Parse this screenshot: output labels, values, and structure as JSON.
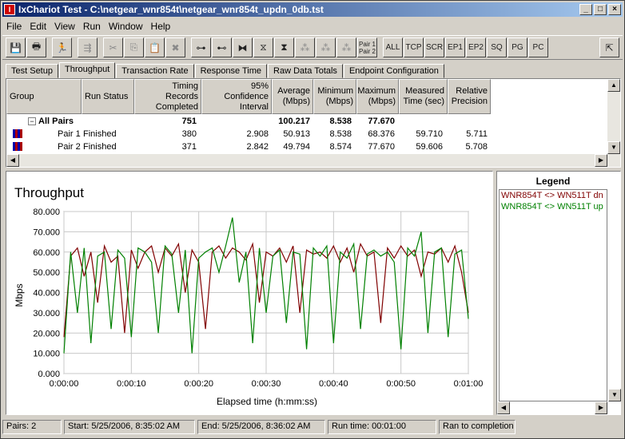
{
  "window": {
    "title": "IxChariot Test - C:\\netgear_wnr854t\\netgear_wnr854t_updn_0db.tst"
  },
  "menu": [
    "File",
    "Edit",
    "View",
    "Run",
    "Window",
    "Help"
  ],
  "toolbar": {
    "pair_label": "Pair 1\nPair 2",
    "text_buttons": [
      "ALL",
      "TCP",
      "SCR",
      "EP1",
      "EP2",
      "SQ",
      "PG",
      "PC"
    ]
  },
  "tabs": [
    "Test Setup",
    "Throughput",
    "Transaction Rate",
    "Response Time",
    "Raw Data Totals",
    "Endpoint Configuration"
  ],
  "table": {
    "headers": [
      "Group",
      "Run Status",
      "Timing Records Completed",
      "95% Confidence Interval",
      "Average (Mbps)",
      "Minimum (Mbps)",
      "Maximum (Mbps)",
      "Measured Time (sec)",
      "Relative Precision"
    ],
    "summary": {
      "group": "All Pairs",
      "records": "751",
      "average": "100.217",
      "minimum": "8.538",
      "maximum": "77.670"
    },
    "rows": [
      {
        "group": "Pair 1",
        "status": "Finished",
        "records": "380",
        "ci": "2.908",
        "average": "50.913",
        "minimum": "8.538",
        "maximum": "68.376",
        "time": "59.710",
        "precision": "5.711"
      },
      {
        "group": "Pair 2",
        "status": "Finished",
        "records": "371",
        "ci": "2.842",
        "average": "49.794",
        "minimum": "8.574",
        "maximum": "77.670",
        "time": "59.606",
        "precision": "5.708"
      }
    ]
  },
  "chart_data": {
    "type": "line",
    "title": "Throughput",
    "xlabel": "Elapsed time (h:mm:ss)",
    "ylabel": "Mbps",
    "ylim": [
      0,
      80
    ],
    "xlim": [
      0,
      60
    ],
    "yticks": [
      "0.000",
      "10.000",
      "20.000",
      "30.000",
      "40.000",
      "50.000",
      "60.000",
      "70.000",
      "80.000"
    ],
    "xticks": [
      "0:00:00",
      "0:00:10",
      "0:00:20",
      "0:00:30",
      "0:00:40",
      "0:00:50",
      "0:01:00"
    ],
    "grid": true,
    "series": [
      {
        "name": "WNR854T <> WN511T dn",
        "color": "#800000",
        "x": [
          0,
          1,
          2,
          3,
          4,
          5,
          6,
          7,
          8,
          9,
          10,
          11,
          12,
          13,
          14,
          15,
          16,
          17,
          18,
          19,
          20,
          21,
          22,
          23,
          24,
          25,
          26,
          27,
          28,
          29,
          30,
          31,
          32,
          33,
          34,
          35,
          36,
          37,
          38,
          39,
          40,
          41,
          42,
          43,
          44,
          45,
          46,
          47,
          48,
          49,
          50,
          51,
          52,
          53,
          54,
          55,
          56,
          57,
          58,
          59,
          60
        ],
        "values": [
          18,
          58,
          62,
          48,
          60,
          35,
          63,
          55,
          58,
          20,
          61,
          52,
          60,
          63,
          50,
          62,
          58,
          64,
          40,
          61,
          55,
          22,
          60,
          63,
          57,
          62,
          60,
          56,
          64,
          35,
          60,
          58,
          62,
          55,
          63,
          30,
          61,
          59,
          60,
          57,
          63,
          55,
          62,
          50,
          64,
          58,
          60,
          25,
          62,
          57,
          63,
          58,
          61,
          48,
          60,
          59,
          62,
          55,
          63,
          50,
          30
        ]
      },
      {
        "name": "WNR854T <> WN511T up",
        "color": "#008000",
        "x": [
          0,
          1,
          2,
          3,
          4,
          5,
          6,
          7,
          8,
          9,
          10,
          11,
          12,
          13,
          14,
          15,
          16,
          17,
          18,
          19,
          20,
          21,
          22,
          23,
          24,
          25,
          26,
          27,
          28,
          29,
          30,
          31,
          32,
          33,
          34,
          35,
          36,
          37,
          38,
          39,
          40,
          41,
          42,
          43,
          44,
          45,
          46,
          47,
          48,
          49,
          50,
          51,
          52,
          53,
          54,
          55,
          56,
          57,
          58,
          59,
          60
        ],
        "values": [
          10,
          60,
          30,
          62,
          15,
          58,
          60,
          22,
          61,
          57,
          18,
          62,
          60,
          55,
          20,
          63,
          59,
          30,
          61,
          10,
          57,
          60,
          62,
          50,
          63,
          77,
          45,
          60,
          15,
          62,
          30,
          58,
          61,
          25,
          60,
          59,
          12,
          62,
          58,
          63,
          15,
          60,
          57,
          64,
          22,
          59,
          61,
          58,
          60,
          55,
          12,
          62,
          58,
          70,
          20,
          60,
          62,
          18,
          59,
          61,
          27
        ]
      }
    ]
  },
  "legend": {
    "title": "Legend",
    "items": [
      "WNR854T <> WN511T dn",
      "WNR854T <> WN511T up"
    ]
  },
  "status": {
    "pairs": "Pairs: 2",
    "start": "Start: 5/25/2006, 8:35:02 AM",
    "end": "End: 5/25/2006, 8:36:02 AM",
    "runtime": "Run time: 00:01:00",
    "result": "Ran to completion"
  },
  "colors": {
    "dn": "#800000",
    "up": "#008000",
    "titlebar": "#0a246a"
  }
}
